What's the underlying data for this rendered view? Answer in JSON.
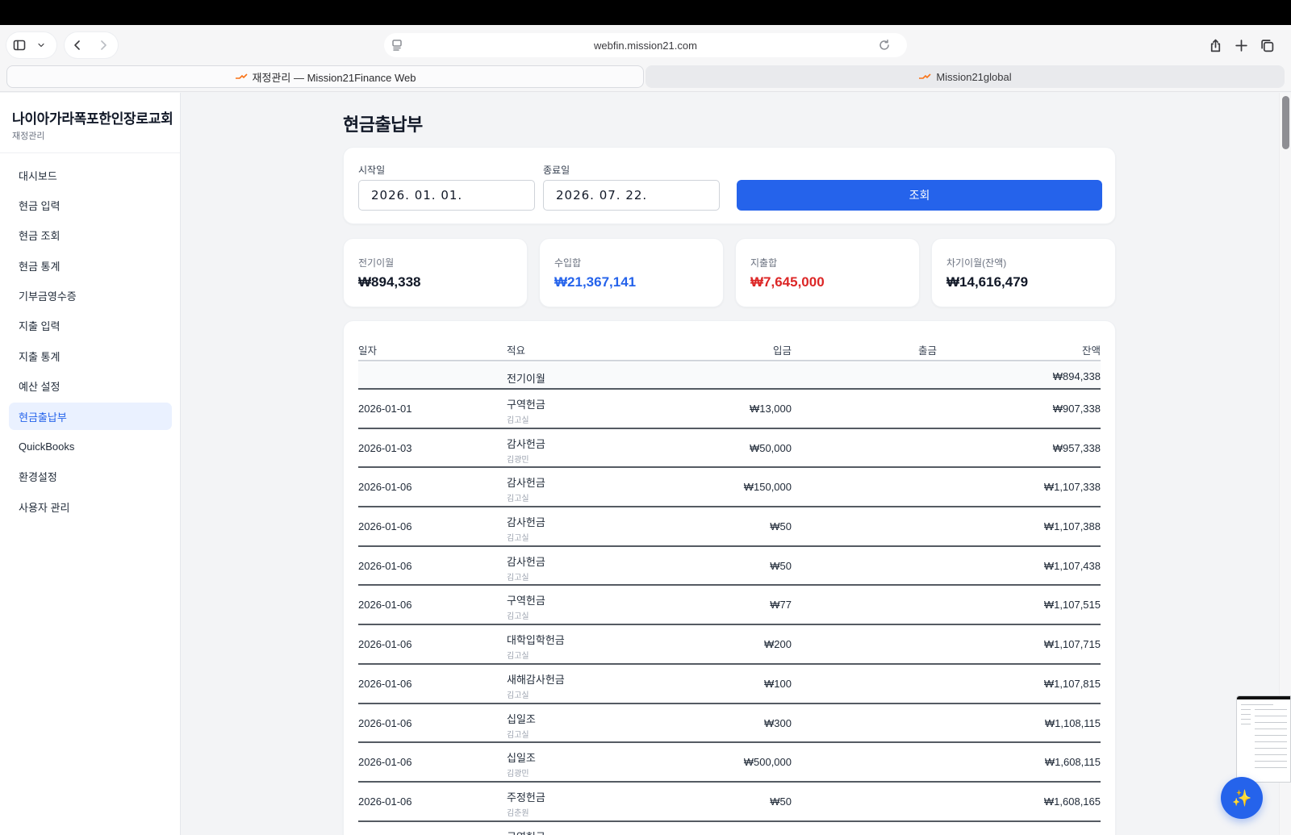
{
  "browser": {
    "url": "webfin.mission21.com",
    "tabs": [
      {
        "label": "재정관리 — Mission21Finance Web",
        "active": true
      },
      {
        "label": "Mission21global",
        "active": false
      }
    ]
  },
  "sidebar": {
    "org_name": "나이아가라폭포한인장로교회",
    "org_sub": "재정관리",
    "items": [
      {
        "label": "대시보드"
      },
      {
        "label": "현금 입력"
      },
      {
        "label": "현금 조회"
      },
      {
        "label": "현금 통계"
      },
      {
        "label": "기부금영수증"
      },
      {
        "label": "지출 입력"
      },
      {
        "label": "지출 통계"
      },
      {
        "label": "예산 설정"
      },
      {
        "label": "현금출납부",
        "active": true
      },
      {
        "label": "QuickBooks"
      },
      {
        "label": "환경설정"
      },
      {
        "label": "사용자 관리"
      }
    ]
  },
  "page": {
    "title": "현금출납부"
  },
  "filter": {
    "start_label": "시작일",
    "start_value": "2026. 01. 01.",
    "end_label": "종료일",
    "end_value": "2026. 07. 22.",
    "search_label": "조회"
  },
  "stats": [
    {
      "label": "전기이월",
      "value": "₩894,338"
    },
    {
      "label": "수입합",
      "value": "₩21,367,141"
    },
    {
      "label": "지출합",
      "value": "₩7,645,000"
    },
    {
      "label": "차기이월(잔액)",
      "value": "₩14,616,479"
    }
  ],
  "ledger": {
    "columns": {
      "date": "일자",
      "desc": "적요",
      "in": "입금",
      "out": "출금",
      "balance": "잔액"
    },
    "carry": {
      "desc": "전기이월",
      "balance": "₩894,338"
    },
    "rows": [
      {
        "date": "2026-01-01",
        "desc": "구역헌금",
        "name": "김고실",
        "in": "₩13,000",
        "out": "",
        "balance": "₩907,338"
      },
      {
        "date": "2026-01-03",
        "desc": "감사헌금",
        "name": "김광민",
        "in": "₩50,000",
        "out": "",
        "balance": "₩957,338"
      },
      {
        "date": "2026-01-06",
        "desc": "감사헌금",
        "name": "김고실",
        "in": "₩150,000",
        "out": "",
        "balance": "₩1,107,338"
      },
      {
        "date": "2026-01-06",
        "desc": "감사헌금",
        "name": "김고실",
        "in": "₩50",
        "out": "",
        "balance": "₩1,107,388"
      },
      {
        "date": "2026-01-06",
        "desc": "감사헌금",
        "name": "김고실",
        "in": "₩50",
        "out": "",
        "balance": "₩1,107,438"
      },
      {
        "date": "2026-01-06",
        "desc": "구역헌금",
        "name": "김고실",
        "in": "₩77",
        "out": "",
        "balance": "₩1,107,515"
      },
      {
        "date": "2026-01-06",
        "desc": "대학입학헌금",
        "name": "김고실",
        "in": "₩200",
        "out": "",
        "balance": "₩1,107,715"
      },
      {
        "date": "2026-01-06",
        "desc": "새해감사헌금",
        "name": "김고실",
        "in": "₩100",
        "out": "",
        "balance": "₩1,107,815"
      },
      {
        "date": "2026-01-06",
        "desc": "십일조",
        "name": "김고실",
        "in": "₩300",
        "out": "",
        "balance": "₩1,108,115"
      },
      {
        "date": "2026-01-06",
        "desc": "십일조",
        "name": "김광민",
        "in": "₩500,000",
        "out": "",
        "balance": "₩1,608,115"
      },
      {
        "date": "2026-01-06",
        "desc": "주정헌금",
        "name": "김춘원",
        "in": "₩50",
        "out": "",
        "balance": "₩1,608,165"
      },
      {
        "date": "",
        "desc": "구역헌금",
        "name": "",
        "in": "",
        "out": "",
        "balance": ""
      }
    ]
  },
  "colors": {
    "accent": "#2563eb",
    "income": "#2563eb",
    "expense": "#dc2626",
    "active_nav_bg": "#eaf1ff"
  },
  "fab": {
    "icon": "sparkles-icon",
    "glyph": "✨"
  }
}
